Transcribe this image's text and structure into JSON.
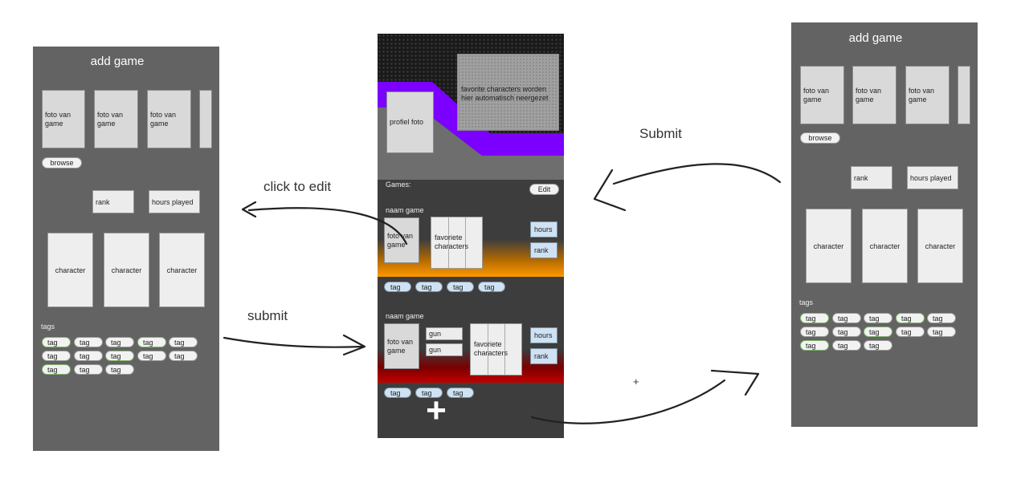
{
  "left_panel": {
    "title": "add game",
    "photos": [
      "foto van game",
      "foto van game",
      "foto van game"
    ],
    "browse_label": "browse",
    "rank_label": "rank",
    "hours_label": "hours played",
    "characters": [
      "character",
      "character",
      "character"
    ],
    "tags_label": "tags",
    "tags": [
      "tag",
      "tag",
      "tag",
      "tag",
      "tag",
      "tag",
      "tag",
      "tag",
      "tag",
      "tag",
      "tag",
      "tag",
      "tag"
    ]
  },
  "center_panel": {
    "profile_label": "profiel foto",
    "favorites_text": "favorite characters worden hier automatisch neergezet",
    "games_label": "Games:",
    "edit_label": "Edit",
    "game1": {
      "name": "naam game",
      "photo": "foto van game",
      "favorites": "favoriete characters",
      "hours": "hours",
      "rank": "rank",
      "tags": [
        "tag",
        "tag",
        "tag",
        "tag"
      ]
    },
    "game2": {
      "name": "naam game",
      "photo": "foto van game",
      "gun1": "gun",
      "gun2": "gun",
      "favorites": "favoriete characters",
      "hours": "hours",
      "rank": "rank",
      "tags": [
        "tag",
        "tag",
        "tag"
      ]
    },
    "add_symbol": "+"
  },
  "right_panel": {
    "title": "add game",
    "photos": [
      "foto van game",
      "foto van game",
      "foto van game"
    ],
    "browse_label": "browse",
    "rank_label": "rank",
    "hours_label": "hours played",
    "characters": [
      "character",
      "character",
      "character"
    ],
    "tags_label": "tags",
    "tags": [
      "tag",
      "tag",
      "tag",
      "tag",
      "tag",
      "tag",
      "tag",
      "tag",
      "tag",
      "tag",
      "tag",
      "tag",
      "tag"
    ]
  },
  "annotations": {
    "click_to_edit": "click to edit",
    "submit_left": "submit",
    "submit_right": "Submit",
    "plus": "+"
  },
  "colors": {
    "panel": "#636363",
    "purple": "#7b00ff",
    "orange": "#ff9900",
    "red": "#c00000",
    "tag_blue": "#cfe2f3",
    "tag_green_border": "#7fb56a"
  }
}
